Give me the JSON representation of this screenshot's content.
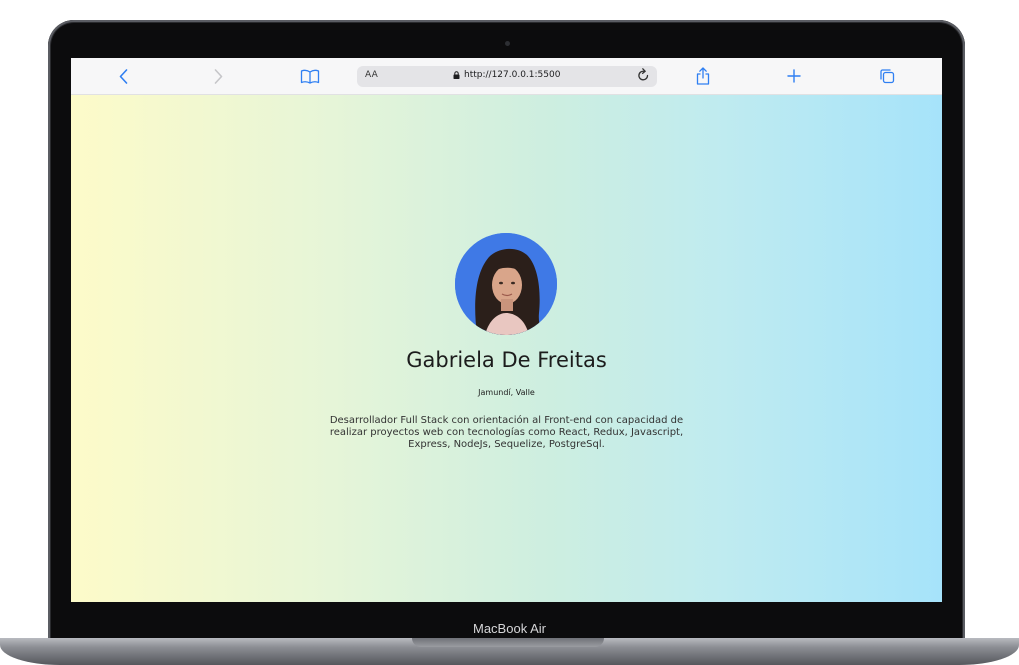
{
  "browser": {
    "text_size_label": "AA",
    "url": "http://127.0.0.1:5500",
    "icons": [
      "back-icon",
      "forward-icon",
      "bookmarks-icon",
      "lock-icon",
      "reload-icon",
      "share-icon",
      "new-tab-icon",
      "tabs-icon"
    ],
    "accent_color": "#2f7ff2"
  },
  "profile": {
    "name": "Gabriela De Freitas",
    "location": "Jamundí, Valle",
    "bio": "Desarrollador Full Stack con orientación al Front-end con capacidad de realizar proyectos web con tecnologías como React, Redux, Javascript, Express, NodeJs, Sequelize, PostgreSql."
  },
  "device": {
    "label": "MacBook Air"
  },
  "colors": {
    "gradient_left": "#fdfbc9",
    "gradient_right": "#a6e3fa",
    "avatar_bg": "#3f79e6"
  }
}
